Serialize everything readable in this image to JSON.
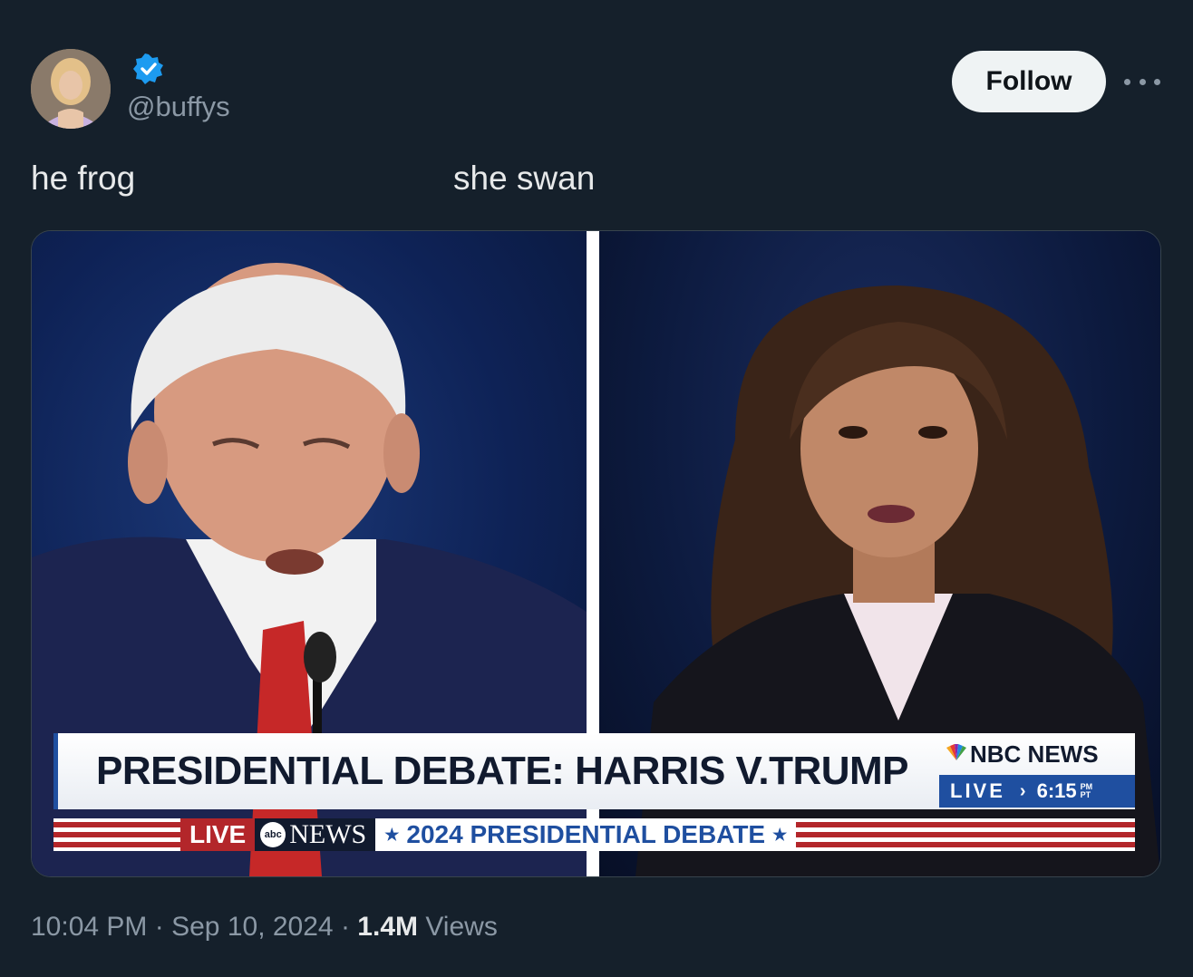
{
  "author": {
    "handle": "@buffys",
    "verified": true,
    "avatar_icon": "avatar-photo",
    "verified_color": "#1d9bf0"
  },
  "header": {
    "follow_label": "Follow",
    "more_icon": "ellipsis-icon"
  },
  "tweet": {
    "text_left": "he frog",
    "text_right": "she swan"
  },
  "media": {
    "headline": "PRESIDENTIAL DEBATE: HARRIS V.TRUMP",
    "network_name": "NBC NEWS",
    "network_live": "LIVE",
    "network_time": "6:15",
    "network_time_suffix": "PM PT",
    "ticker_live": "LIVE",
    "ticker_logo_abc": "abc",
    "ticker_news": "NEWS",
    "ticker_text": "2024 PRESIDENTIAL DEBATE",
    "accent_red": "#b3262a",
    "accent_blue": "#1f4fa0"
  },
  "footer": {
    "time": "10:04 PM",
    "separator": "·",
    "date": "Sep 10, 2024",
    "views_count": "1.4M",
    "views_label": "Views"
  }
}
